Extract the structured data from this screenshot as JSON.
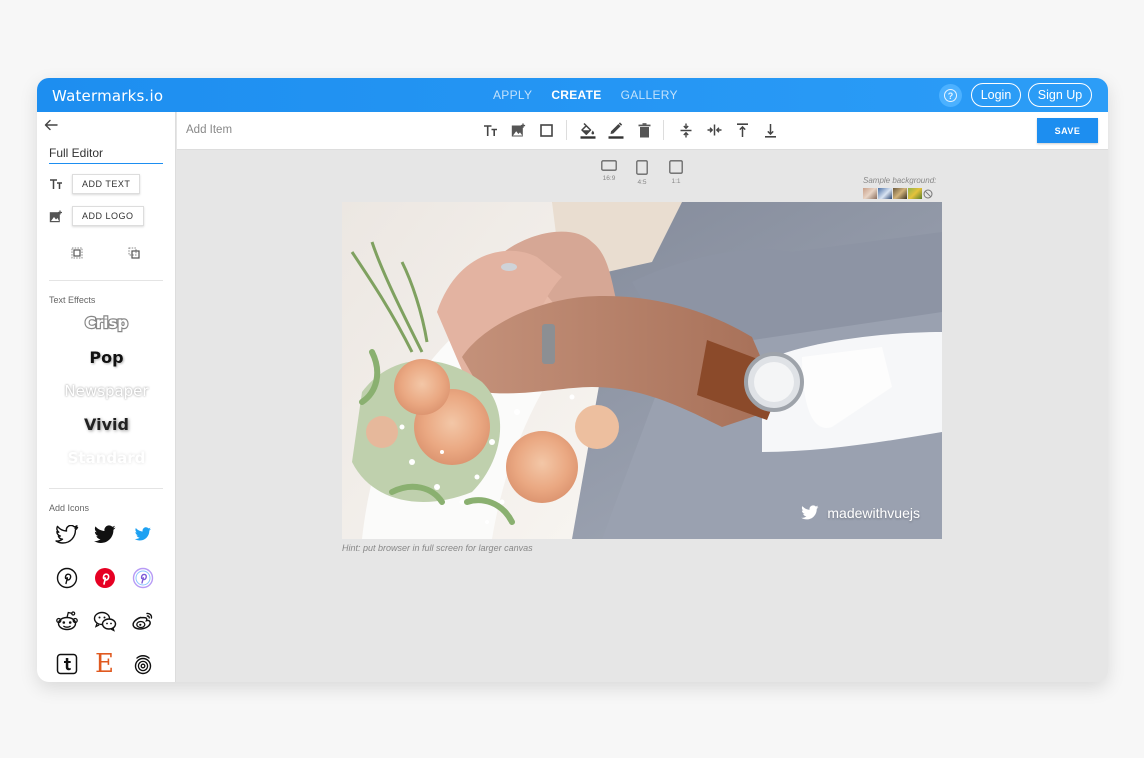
{
  "header": {
    "brand": "Watermarks.io",
    "nav": [
      "APPLY",
      "CREATE",
      "GALLERY"
    ],
    "active_nav": "CREATE",
    "help_label": "?",
    "login_label": "Login",
    "signup_label": "Sign Up"
  },
  "sidebar": {
    "editor_name": "Full Editor",
    "add_text_label": "ADD TEXT",
    "add_logo_label": "ADD LOGO",
    "text_effects_title": "Text Effects",
    "effects": [
      "Crisp",
      "Pop",
      "Newspaper",
      "Vivid",
      "Standard"
    ],
    "add_icons_title": "Add Icons",
    "icons": [
      "twitter-outline-icon",
      "twitter-black-icon",
      "twitter-blue-icon",
      "pinterest-outline-icon",
      "pinterest-red-icon",
      "pinterest-purple-icon",
      "reddit-icon",
      "wechat-icon",
      "weibo-icon",
      "tumblr-icon",
      "etsy-icon",
      "500px-icon"
    ]
  },
  "toolbar": {
    "add_item_label": "Add Item",
    "save_label": "SAVE"
  },
  "canvas": {
    "ratios": [
      "16:9",
      "4:5",
      "1:1"
    ],
    "sample_background_label": "Sample background:",
    "hint": "Hint: put browser in full screen for larger canvas",
    "watermark_text": "madewithvuejs"
  },
  "colors": {
    "accent": "#1d8ef0",
    "header_gradient_start": "#1d8ef0",
    "header_gradient_end": "#2c9df7",
    "etsy": "#e05a20",
    "pinterest": "#e60023",
    "twitter": "#1da1f2"
  }
}
